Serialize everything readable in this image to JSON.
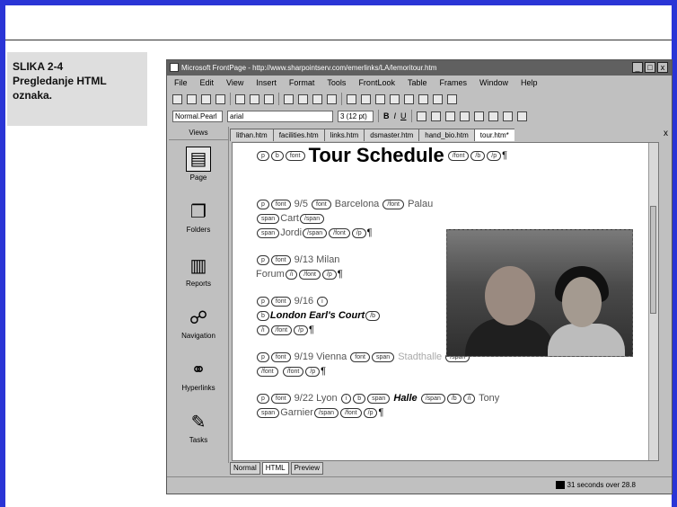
{
  "caption": {
    "label": "SLIKA 2-4",
    "text": "Pregledanje HTML oznaka."
  },
  "window": {
    "title": "Microsoft FrontPage - http://www.sharpointserv.com/emerlinks/LA/lemoritour.htm",
    "controls": [
      "_",
      "□",
      "x"
    ]
  },
  "menu": [
    "File",
    "Edit",
    "View",
    "Insert",
    "Format",
    "Tools",
    "FrontLook",
    "Table",
    "Frames",
    "Window",
    "Help"
  ],
  "toolbar": {
    "style_combo": "Normal.Pearl",
    "font_combo": "arial",
    "size_combo": "3 (12 pt)",
    "bold": "B",
    "italic": "I",
    "underline": "U"
  },
  "views": {
    "header": "Views",
    "items": [
      {
        "label": "Page",
        "icon": "page-icon"
      },
      {
        "label": "Folders",
        "icon": "folder-icon"
      },
      {
        "label": "Reports",
        "icon": "reports-icon"
      },
      {
        "label": "Navigation",
        "icon": "navigation-icon"
      },
      {
        "label": "Hyperlinks",
        "icon": "hyperlinks-icon"
      },
      {
        "label": "Tasks",
        "icon": "tasks-icon"
      }
    ]
  },
  "tabs": [
    "lithan.htm",
    "facilities.htm",
    "links.htm",
    "dsmaster.htm",
    "hand_bio.htm",
    "tour.htm*"
  ],
  "tab_close": "x",
  "document": {
    "heading": "Tour Schedule",
    "pilcrow": "¶",
    "lines": [
      {
        "date": "9/5",
        "city": "Barcelona",
        "extra": "Palau"
      },
      {
        "text1": "Cart",
        "text2": "Jordi"
      },
      {
        "date": "9/13",
        "city": "Milan",
        "extra": "Forum"
      },
      {
        "date": "9/16",
        "venue": "London Earl's Court"
      },
      {
        "date": "9/19",
        "city": "Vienna",
        "extra": "Stadthalle"
      },
      {
        "date": "9/22",
        "city": "Lyon",
        "venue": "Halle",
        "extra": "Tony",
        "extra2": "Garnier"
      }
    ],
    "tags": {
      "p": "p",
      "b": "b",
      "i": "i",
      "font": "font",
      "span": "span",
      "end_font": "/font",
      "end_b": "/b",
      "end_i": "/i",
      "end_p": "/p",
      "end_span": "/span"
    }
  },
  "bottom_tabs": [
    "Normal",
    "HTML",
    "Preview"
  ],
  "status": {
    "text": "31 seconds over 28.8"
  }
}
